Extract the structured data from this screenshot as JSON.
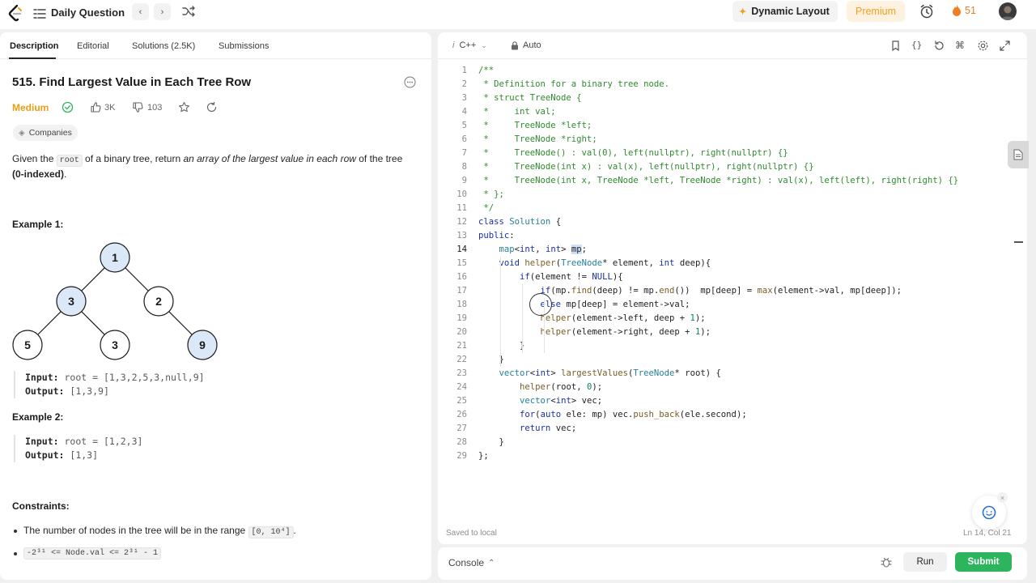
{
  "header": {
    "title": "Daily Question",
    "prev_glyph": "‹",
    "next_glyph": "›",
    "dynamic_layout_label": "Dynamic Layout",
    "premium_label": "Premium",
    "streak_count": "51",
    "icons": [
      "logo-icon",
      "list-icon",
      "shuffle-icon",
      "layout-icon",
      "clock-icon",
      "fire-icon",
      "avatar"
    ]
  },
  "left": {
    "tabs": [
      "Description",
      "Editorial",
      "Solutions (2.5K)",
      "Submissions"
    ],
    "active_tab": "Description",
    "problem_title": "515. Find Largest Value in Each Tree Row",
    "difficulty": "Medium",
    "likes": "3K",
    "dislikes": "103",
    "companies_label": "Companies",
    "description": {
      "p1": "Given the ",
      "code_root": "root",
      "p2": " of a binary tree, return ",
      "em": "an array of the largest value in each row",
      "p3": " of the tree ",
      "bold": "(0-indexed)",
      "p4": "."
    },
    "example1": {
      "title": "Example 1:",
      "input_label": "Input:",
      "input_value": "root = [1,3,2,5,3,null,9]",
      "output_label": "Output:",
      "output_value": "[1,3,9]",
      "tree_nodes": [
        {
          "value": "1",
          "highlight": true
        },
        {
          "value": "3",
          "highlight": true
        },
        {
          "value": "2",
          "highlight": false
        },
        {
          "value": "5",
          "highlight": false
        },
        {
          "value": "3",
          "highlight": false
        },
        {
          "value": "9",
          "highlight": true
        }
      ]
    },
    "example2": {
      "title": "Example 2:",
      "input_label": "Input:",
      "input_value": "root = [1,2,3]",
      "output_label": "Output:",
      "output_value": "[1,3]"
    },
    "constraints": {
      "title": "Constraints:",
      "c1_text": "The number of nodes in the tree will be in the range",
      "c1_code": "[0, 10⁴]",
      "c1_end": ".",
      "c2_code": "-2³¹ <= Node.val <= 2³¹ - 1"
    }
  },
  "editor": {
    "language": "C++",
    "mode": "Auto",
    "saved_status": "Saved to local",
    "cursor_position": "Ln 14, Col 21",
    "current_line": 14,
    "lines": [
      "/**",
      " * Definition for a binary tree node.",
      " * struct TreeNode {",
      " *     int val;",
      " *     TreeNode *left;",
      " *     TreeNode *right;",
      " *     TreeNode() : val(0), left(nullptr), right(nullptr) {}",
      " *     TreeNode(int x) : val(x), left(nullptr), right(nullptr) {}",
      " *     TreeNode(int x, TreeNode *left, TreeNode *right) : val(x), left(left), right(right) {}",
      " * };",
      " */",
      "class Solution {",
      "public:",
      "    map<int, int> mp;",
      "    void helper(TreeNode* element, int deep){",
      "        if(element != NULL){",
      "            if(mp.find(deep) != mp.end())  mp[deep] = max(element->val, mp[deep]);",
      "            else mp[deep] = element->val;",
      "            helper(element->left, deep + 1);",
      "            helper(element->right, deep + 1);",
      "        }",
      "    }",
      "    vector<int> largestValues(TreeNode* root) {",
      "        helper(root, 0);",
      "        vector<int> vec;",
      "        for(auto ele: mp) vec.push_back(ele.second);",
      "        return vec;",
      "    }",
      "};"
    ]
  },
  "console": {
    "label": "Console",
    "run_label": "Run",
    "submit_label": "Submit"
  },
  "colors": {
    "accent_green": "#2db55d",
    "difficulty_medium": "#e7a016",
    "premium": "#f0a020",
    "node_highlight": "#dbe8f7",
    "comment_green": "#2f8a2f"
  }
}
